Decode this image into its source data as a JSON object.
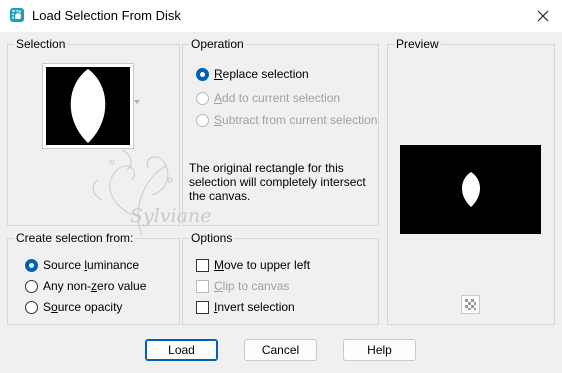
{
  "window": {
    "title": "Load Selection From Disk"
  },
  "groups": {
    "selection": "Selection",
    "operation": "Operation",
    "preview": "Preview",
    "create": "Create selection from:",
    "options": "Options"
  },
  "operation": {
    "replace": {
      "pre": "",
      "key": "R",
      "post": "eplace selection"
    },
    "add": {
      "pre": "",
      "key": "A",
      "post": "dd to current selection"
    },
    "subtract": {
      "pre": "",
      "key": "S",
      "post": "ubtract from current selection"
    }
  },
  "info_text": "The original rectangle for this selection will completely intersect the canvas.",
  "create": {
    "luminance": {
      "pre": "Source ",
      "key": "l",
      "post": "uminance"
    },
    "nonzero": {
      "pre": "Any non-",
      "key": "z",
      "post": "ero value"
    },
    "opacity": {
      "pre": "S",
      "key": "o",
      "post": "urce opacity"
    }
  },
  "options": {
    "move": {
      "pre": "",
      "key": "M",
      "post": "ove to upper left"
    },
    "clip": {
      "pre": "",
      "key": "C",
      "post": "lip to canvas"
    },
    "invert": {
      "pre": "",
      "key": "I",
      "post": "nvert selection"
    }
  },
  "watermark": "Sylviane",
  "buttons": {
    "load": "Load",
    "cancel": "Cancel",
    "help": "Help"
  },
  "icons": {
    "app": "selection-app-icon",
    "close": "close-icon",
    "dropdown": "chevron-down-icon",
    "preview_toggle": "checkerboard-icon"
  },
  "colors": {
    "accent": "#005fb8",
    "window_bg": "#f0f0f0",
    "preview_bg": "#000000"
  }
}
